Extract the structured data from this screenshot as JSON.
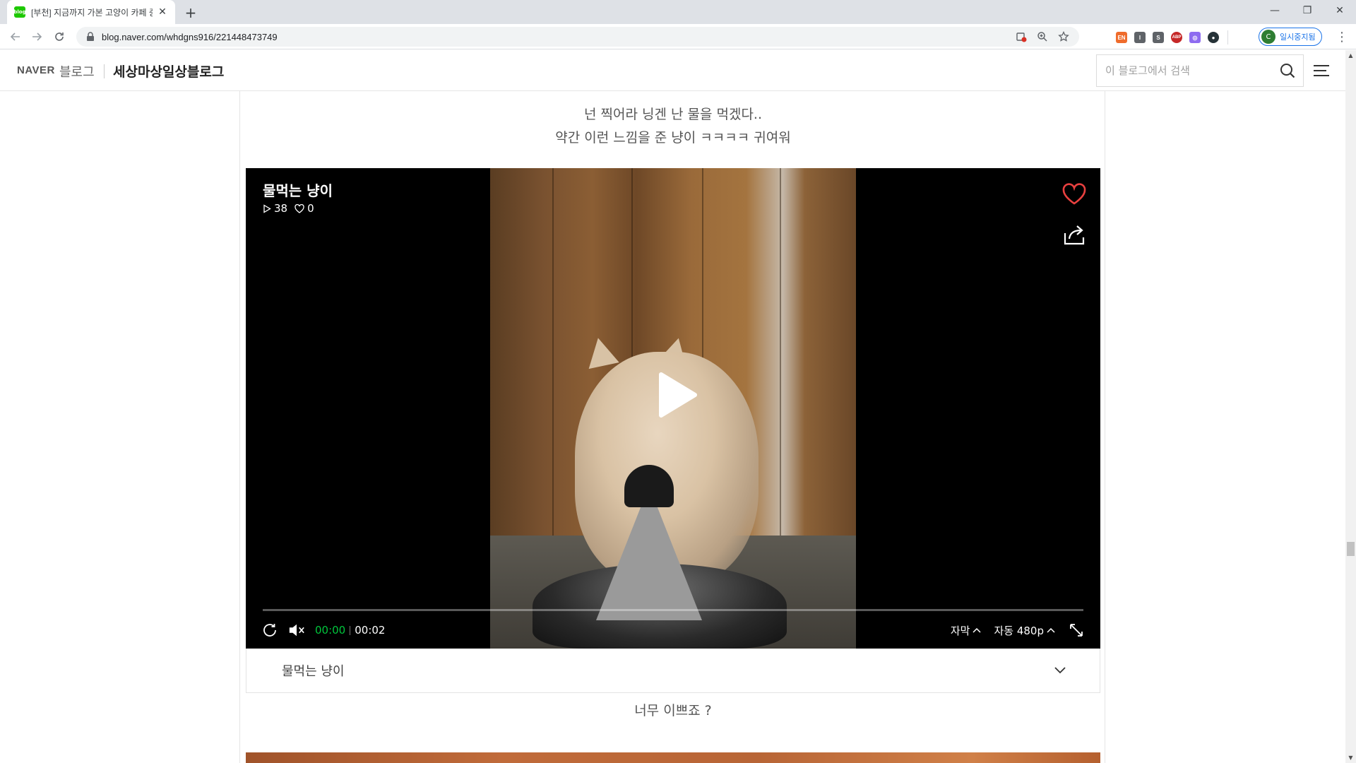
{
  "browser": {
    "tab_title": "[부천] 지금까지 가본 고양이 카페 중",
    "favicon_label": "blog",
    "url": "blog.naver.com/whdgns916/221448473749",
    "profile_initial": "C",
    "profile_label": "일시중지됨",
    "extensions": [
      {
        "name": "ext-orange",
        "label": "EN",
        "color": "#ef6c2c"
      },
      {
        "name": "ext-gray",
        "label": "I",
        "color": "#5f6368"
      },
      {
        "name": "ext-s",
        "label": "S",
        "color": "#5f6368"
      },
      {
        "name": "ext-abp",
        "label": "ABP",
        "color": "#c62828"
      },
      {
        "name": "ext-instagram",
        "label": "◎",
        "color": "#8e6cf0"
      },
      {
        "name": "ext-dark",
        "label": "●",
        "color": "#263238"
      }
    ]
  },
  "header": {
    "naver_logo": "NAVER",
    "blog_word": "블로그",
    "blog_name": "세상마상일상블로그",
    "search_placeholder": "이 블로그에서 검색"
  },
  "post": {
    "text_line1": "넌 찍어라 닝겐 난 물을 먹겠다..",
    "text_line2": "약간 이런 느낌을 준 냥이 ㅋㅋㅋㅋ 귀여워",
    "text_after": "너무 이쁘죠 ?"
  },
  "video": {
    "title": "물먹는 냥이",
    "views": "38",
    "likes": "0",
    "time_current": "00:00",
    "time_total": "00:02",
    "progress": 0.0,
    "subtitle_label": "자막",
    "quality_label": "자동 480p",
    "caption": "물먹는 냥이",
    "colors": {
      "accent": "#00c73c",
      "heart": "#e8403f"
    }
  }
}
